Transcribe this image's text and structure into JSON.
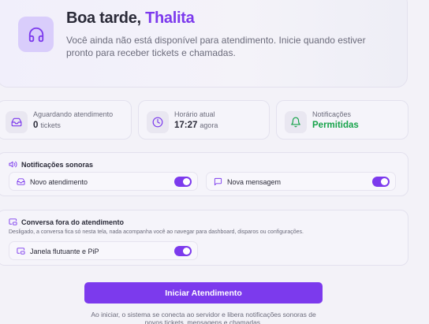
{
  "hero": {
    "greeting_prefix": "Boa tarde,",
    "user_name": "Thalita",
    "description": "Você ainda não está disponível para atendimento. Inicie quando estiver pronto para receber tickets e chamadas.",
    "icon": "headphones-icon"
  },
  "stats": [
    {
      "icon": "inbox-icon",
      "label": "Aguardando atendimento",
      "value": "0",
      "sub": "tickets"
    },
    {
      "icon": "clock-icon",
      "label": "Horário atual",
      "value": "17:27",
      "sub": "agora"
    },
    {
      "icon": "bell-icon",
      "label": "Notificações",
      "value": "Permitidas",
      "value_color": "#16a34a"
    }
  ],
  "sound_notifications": {
    "title": "Notificações sonoras",
    "icon": "volume-icon",
    "items": [
      {
        "icon": "inbox-icon",
        "label": "Novo atendimento",
        "enabled": true
      },
      {
        "icon": "message-icon",
        "label": "Nova mensagem",
        "enabled": true
      }
    ]
  },
  "outside_conversation": {
    "title": "Conversa fora do atendimento",
    "icon": "picture-in-picture-icon",
    "description": "Desligado, a conversa fica só nesta tela, nada acompanha você ao navegar para dashboard, disparos ou configurações.",
    "items": [
      {
        "icon": "picture-in-picture-icon",
        "label": "Janela flutuante e PiP",
        "enabled": true
      }
    ]
  },
  "start_button_label": "Iniciar Atendimento",
  "footer_note": "Ao iniciar, o sistema se conecta ao servidor e libera notificações sonoras de novos tickets, mensagens e chamadas.",
  "colors": {
    "accent": "#7c3aed",
    "success": "#16a34a",
    "accent_light": "#d9cdfb"
  }
}
